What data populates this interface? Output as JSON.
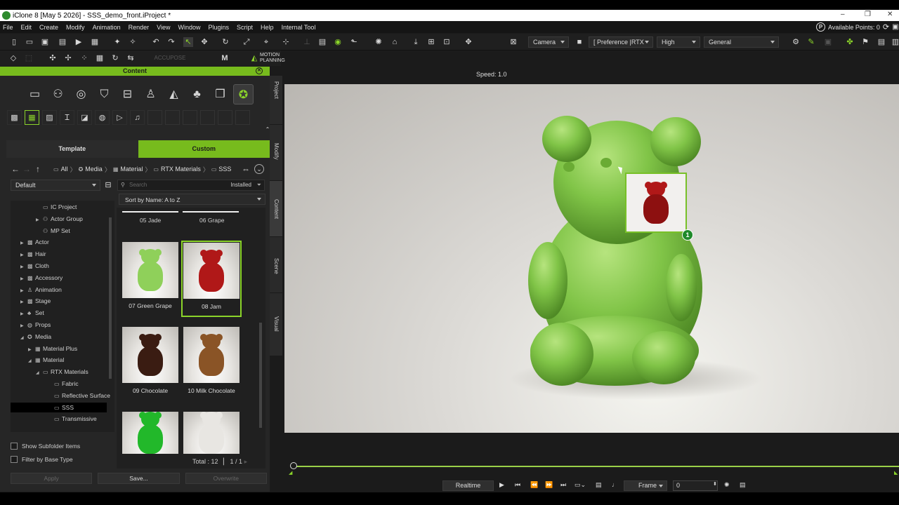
{
  "window": {
    "title": "iClone 8 [May  5 2026] - SSS_demo_front.iProject *",
    "min": "–",
    "max": "❐",
    "close": "✕"
  },
  "menu": {
    "items": [
      "File",
      "Edit",
      "Create",
      "Modify",
      "Animation",
      "Render",
      "View",
      "Window",
      "Plugins",
      "Script",
      "Help",
      "Internal Tool"
    ],
    "points": "Available Points: 0",
    "points_icon": "P"
  },
  "toolbar": {
    "speed": "Speed: 1.0",
    "camera": "Camera",
    "preference": "[ Preference |RTX",
    "quality": "High",
    "general": "General",
    "accupose": "ACCUPOSE",
    "motion_planning": "MOTION PLANNING",
    "m_label": "M"
  },
  "content": {
    "header": "Content",
    "tabs": [
      "Template",
      "Custom"
    ],
    "breadcrumb": [
      "All",
      "Media",
      "Material",
      "RTX Materials",
      "SSS"
    ],
    "filter": "Default",
    "search_placeholder": "Search",
    "installed": "Installed",
    "sort": "Sort by Name: A to Z",
    "tree": [
      {
        "label": "IC Project",
        "indent": 3,
        "tri": ""
      },
      {
        "label": "Actor Group",
        "indent": 3,
        "tri": "▶"
      },
      {
        "label": "MP Set",
        "indent": 3,
        "tri": ""
      },
      {
        "label": "Actor",
        "indent": 1,
        "tri": "▶"
      },
      {
        "label": "Hair",
        "indent": 1,
        "tri": "▶"
      },
      {
        "label": "Cloth",
        "indent": 1,
        "tri": "▶"
      },
      {
        "label": "Accessory",
        "indent": 1,
        "tri": "▶"
      },
      {
        "label": "Animation",
        "indent": 1,
        "tri": "▶"
      },
      {
        "label": "Stage",
        "indent": 1,
        "tri": "▶"
      },
      {
        "label": "Set",
        "indent": 1,
        "tri": "▶"
      },
      {
        "label": "Props",
        "indent": 1,
        "tri": "▶"
      },
      {
        "label": "Media",
        "indent": 1,
        "tri": "◢"
      },
      {
        "label": "Material Plus",
        "indent": 2,
        "tri": "▶"
      },
      {
        "label": "Material",
        "indent": 2,
        "tri": "◢"
      },
      {
        "label": "RTX Materials",
        "indent": 3,
        "tri": "◢"
      },
      {
        "label": "Fabric",
        "indent": 4,
        "tri": ""
      },
      {
        "label": "Reflective Surface",
        "indent": 4,
        "tri": ""
      },
      {
        "label": "SSS",
        "indent": 4,
        "tri": "",
        "selected": true
      },
      {
        "label": "Transmissive",
        "indent": 4,
        "tri": ""
      }
    ],
    "items_top": [
      "05 Jade",
      "06 Grape"
    ],
    "items": [
      {
        "label": "07 Green Grape",
        "color": "#8fd05a"
      },
      {
        "label": "08 Jam",
        "color": "#b01818",
        "selected": true
      },
      {
        "label": "09 Chocolate",
        "color": "#3a1c12"
      },
      {
        "label": "10 Milk Chocolate",
        "color": "#8a5426"
      },
      {
        "label": "",
        "color": "#22b82a"
      },
      {
        "label": "",
        "color": "#e8e6e2"
      }
    ],
    "total": "Total : 12",
    "page": "1",
    "page_sep": "/",
    "page_count": "1",
    "checks": [
      "Show Subfolder Items",
      "Filter by Base Type"
    ],
    "buttons": [
      "Apply",
      "Save...",
      "Overwrite"
    ]
  },
  "side_tabs": [
    "Project",
    "Modify",
    "Content",
    "Scene",
    "Visual"
  ],
  "viewport": {
    "drag_badge": "1",
    "gummy_color": "#7cc044"
  },
  "playback": {
    "mode": "Realtime",
    "unit": "Frame",
    "frame": "0"
  }
}
